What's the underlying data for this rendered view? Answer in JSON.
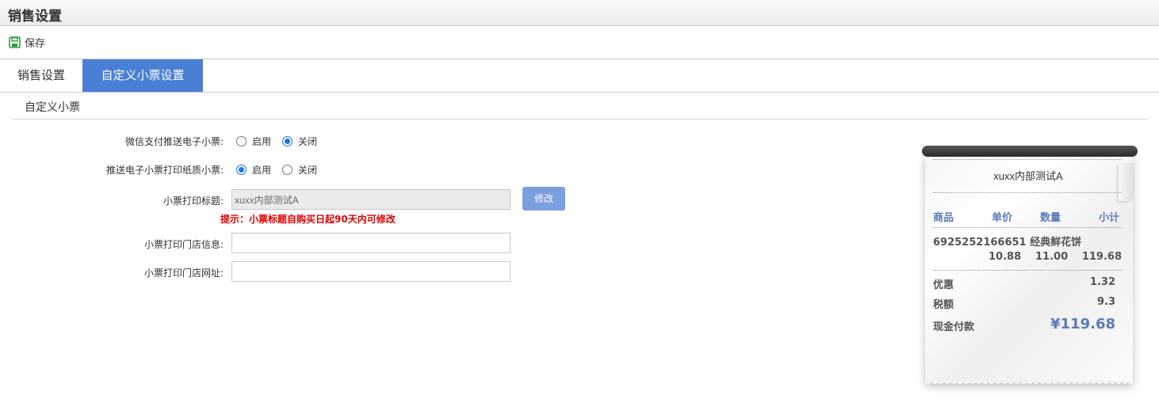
{
  "header": {
    "title": "销售设置"
  },
  "toolbar": {
    "save_label": "保存",
    "save_icon": "floppy-disk-icon"
  },
  "tabs": [
    {
      "label": "销售设置",
      "active": false
    },
    {
      "label": "自定义小票设置",
      "active": true
    }
  ],
  "section": {
    "title": "自定义小票"
  },
  "form": {
    "wechat_push": {
      "label": "微信支付推送电子小票:",
      "options": [
        "启用",
        "关闭"
      ],
      "selected": "关闭"
    },
    "print_paper": {
      "label": "推送电子小票打印纸质小票:",
      "options": [
        "启用",
        "关闭"
      ],
      "selected": "启用"
    },
    "print_title": {
      "label": "小票打印标题:",
      "value": "xuxx内部测试A",
      "edit_label": "修改"
    },
    "hint": "提示：小票标题自购买日起90天内可修改",
    "store_info": {
      "label": "小票打印门店信息:",
      "value": ""
    },
    "store_url": {
      "label": "小票打印门店网址:",
      "value": ""
    }
  },
  "receipt": {
    "title": "xuxx内部测试A",
    "headers": {
      "item": "商品",
      "price": "单价",
      "qty": "数量",
      "subtotal": "小计"
    },
    "item_line": "6925252166651 经典鲜花饼",
    "price": "10.88",
    "qty": "11.00",
    "subtotal": "119.68",
    "discount_label": "优惠",
    "discount": "1.32",
    "tax_label": "税额",
    "tax": "9.3",
    "cash_label": "现金付款",
    "cash": "¥119.68"
  },
  "colors": {
    "accent": "#4a7fd6",
    "button": "#7b9fdf",
    "hint": "#e00000",
    "receipt_accent": "#5a7bb8"
  }
}
